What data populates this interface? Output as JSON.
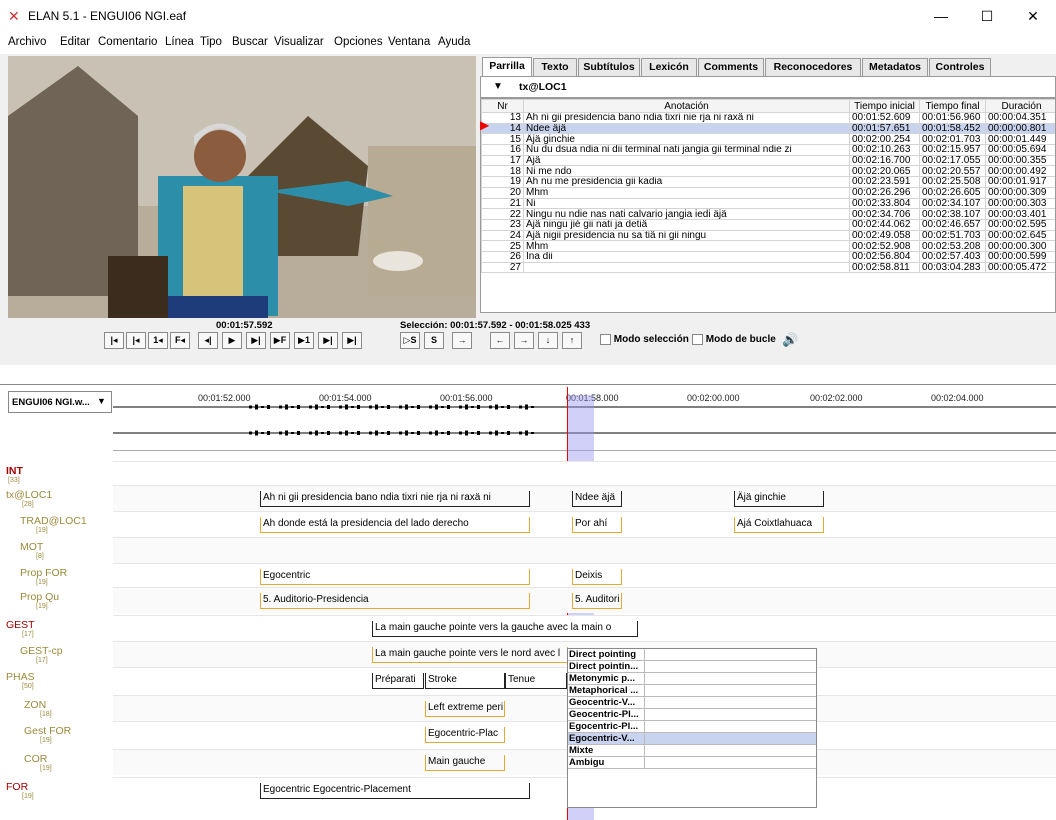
{
  "window": {
    "title": "ELAN 5.1 - ENGUI06 NGI.eaf"
  },
  "menu": [
    "Archivo",
    "Editar",
    "Comentario",
    "Línea",
    "Tipo",
    "Buscar",
    "Visualizar",
    "Opciones",
    "Ventana",
    "Ayuda"
  ],
  "tabs": [
    "Parrilla",
    "Texto",
    "Subtítulos",
    "Lexicón",
    "Comments",
    "Reconocedores",
    "Metadatos",
    "Controles"
  ],
  "grid": {
    "tier": "tx@LOC1",
    "headers": [
      "Nr",
      "Anotación",
      "Tiempo inicial",
      "Tiempo final",
      "Duración"
    ],
    "rows": [
      [
        "13",
        "Ah ni gii presidencia bano ndia tixri nie rja ni raxä ni",
        "00:01:52.609",
        "00:01:56.960",
        "00:00:04.351"
      ],
      [
        "14",
        "Ndee äjä",
        "00:01:57.651",
        "00:01:58.452",
        "00:00:00.801"
      ],
      [
        "15",
        "Äjä ginchie",
        "00:02:00.254",
        "00:02:01.703",
        "00:00:01.449"
      ],
      [
        "16",
        "Nu du dsua ndia ni dii terminal nati jangia gii terminal ndie zi",
        "00:02:10.263",
        "00:02:15.957",
        "00:00:05.694"
      ],
      [
        "17",
        "Äjä",
        "00:02:16.700",
        "00:02:17.055",
        "00:00:00.355"
      ],
      [
        "18",
        "Ni me ndo",
        "00:02:20.065",
        "00:02:20.557",
        "00:00:00.492"
      ],
      [
        "19",
        "Ah nu me presidencia gii kadia",
        "00:02:23.591",
        "00:02:25.508",
        "00:00:01.917"
      ],
      [
        "20",
        "Mhm",
        "00:02:26.296",
        "00:02:26.605",
        "00:00:00.309"
      ],
      [
        "21",
        "Ni",
        "00:02:33.804",
        "00:02:34.107",
        "00:00:00.303"
      ],
      [
        "22",
        "Ningu nu ndie nas nati calvario jangia iedi äjä",
        "00:02:34.706",
        "00:02:38.107",
        "00:00:03.401"
      ],
      [
        "23",
        "Äjä ningu jié gii nati ja detiä",
        "00:02:44.062",
        "00:02:46.657",
        "00:00:02.595"
      ],
      [
        "24",
        "Äjä nigii presidencia nu sa tiä ni gii ningu",
        "00:02:49.058",
        "00:02:51.703",
        "00:00:02.645"
      ],
      [
        "25",
        "Mhm",
        "00:02:52.908",
        "00:02:53.208",
        "00:00:00.300"
      ],
      [
        "26",
        "Ina dii",
        "00:02:56.804",
        "00:02:57.403",
        "00:00:00.599"
      ],
      [
        "27",
        "",
        "00:02:58.811",
        "00:03:04.283",
        "00:00:05.472"
      ]
    ]
  },
  "player": {
    "time": "00:01:57.592",
    "selection": "Selección: 00:01:57.592 - 00:01:58.025  433",
    "buttons": [
      "|◂",
      "|◂",
      "1◂",
      "F◂",
      "◂|",
      "▶",
      "▶|",
      "▶F",
      "▶1",
      "▶|",
      "▶|"
    ],
    "sel_buttons": [
      "▷S",
      "S",
      "→"
    ],
    "nav_buttons": [
      "←",
      "→",
      "↓",
      "↑"
    ],
    "modo_seleccion": "Modo selección",
    "modo_bucle": "Modo de bucle"
  },
  "waveform": {
    "file": "ENGUI06 NGI.w..."
  },
  "ticks": [
    "00:01:52.000",
    "00:01:54.000",
    "00:01:56.000",
    "00:01:58.000",
    "00:02:00.000",
    "00:02:02.000",
    "00:02:04.000"
  ],
  "tiers": [
    {
      "name": "INT",
      "count": "[33]"
    },
    {
      "name": "tx@LOC1",
      "count": "[28]"
    },
    {
      "name": "TRAD@LOC1",
      "count": "[19]"
    },
    {
      "name": "MOT",
      "count": "[8]"
    },
    {
      "name": "Prop FOR",
      "count": "[19]"
    },
    {
      "name": "Prop Qu",
      "count": "[19]"
    },
    {
      "name": "GEST",
      "count": "[17]"
    },
    {
      "name": "GEST-cp",
      "count": "[17]"
    },
    {
      "name": "PHAS",
      "count": "[50]"
    },
    {
      "name": "ZON",
      "count": "[18]"
    },
    {
      "name": "Gest FOR",
      "count": "[19]"
    },
    {
      "name": "COR",
      "count": "[19]"
    },
    {
      "name": "FOR",
      "count": "[19]"
    }
  ],
  "annotations": {
    "tx1": "Ah ni gii presidencia bano ndia tixri nie rja ni raxä ni",
    "tx2": "Ndee äjä",
    "tx3": "Äjä ginchie",
    "trad1": "Ah donde está la presidencia del lado derecho",
    "trad2": "Por ahí",
    "trad3": "Ajá Coixtlahuaca",
    "pf1": "Egocentric",
    "pf2": "Deixis",
    "pq1": "5. Auditorio-Presidencia",
    "pq2": "5. Auditori",
    "gest1": "La main gauche pointe vers la gauche avec la main o",
    "gestcp1": "La main gauche pointe vers le nord avec l",
    "phas1": "Préparati",
    "phas2": "Stroke",
    "phas3": "Tenue",
    "zon1": "Left extreme peri",
    "gf1": "Egocentric-Plac",
    "cor1": "Main gauche",
    "for1": "Egocentric Egocentric-Placement"
  },
  "cv_options": [
    "Direct pointing",
    "Direct pointin...",
    "Metonymic p...",
    "Metaphorical ...",
    "Geocentric-V...",
    "Geocentric-Pl...",
    "Egocentric-Pl...",
    "Egocentric-V...",
    "Mixte",
    "Ambigu"
  ],
  "cv_selected_index": 7
}
